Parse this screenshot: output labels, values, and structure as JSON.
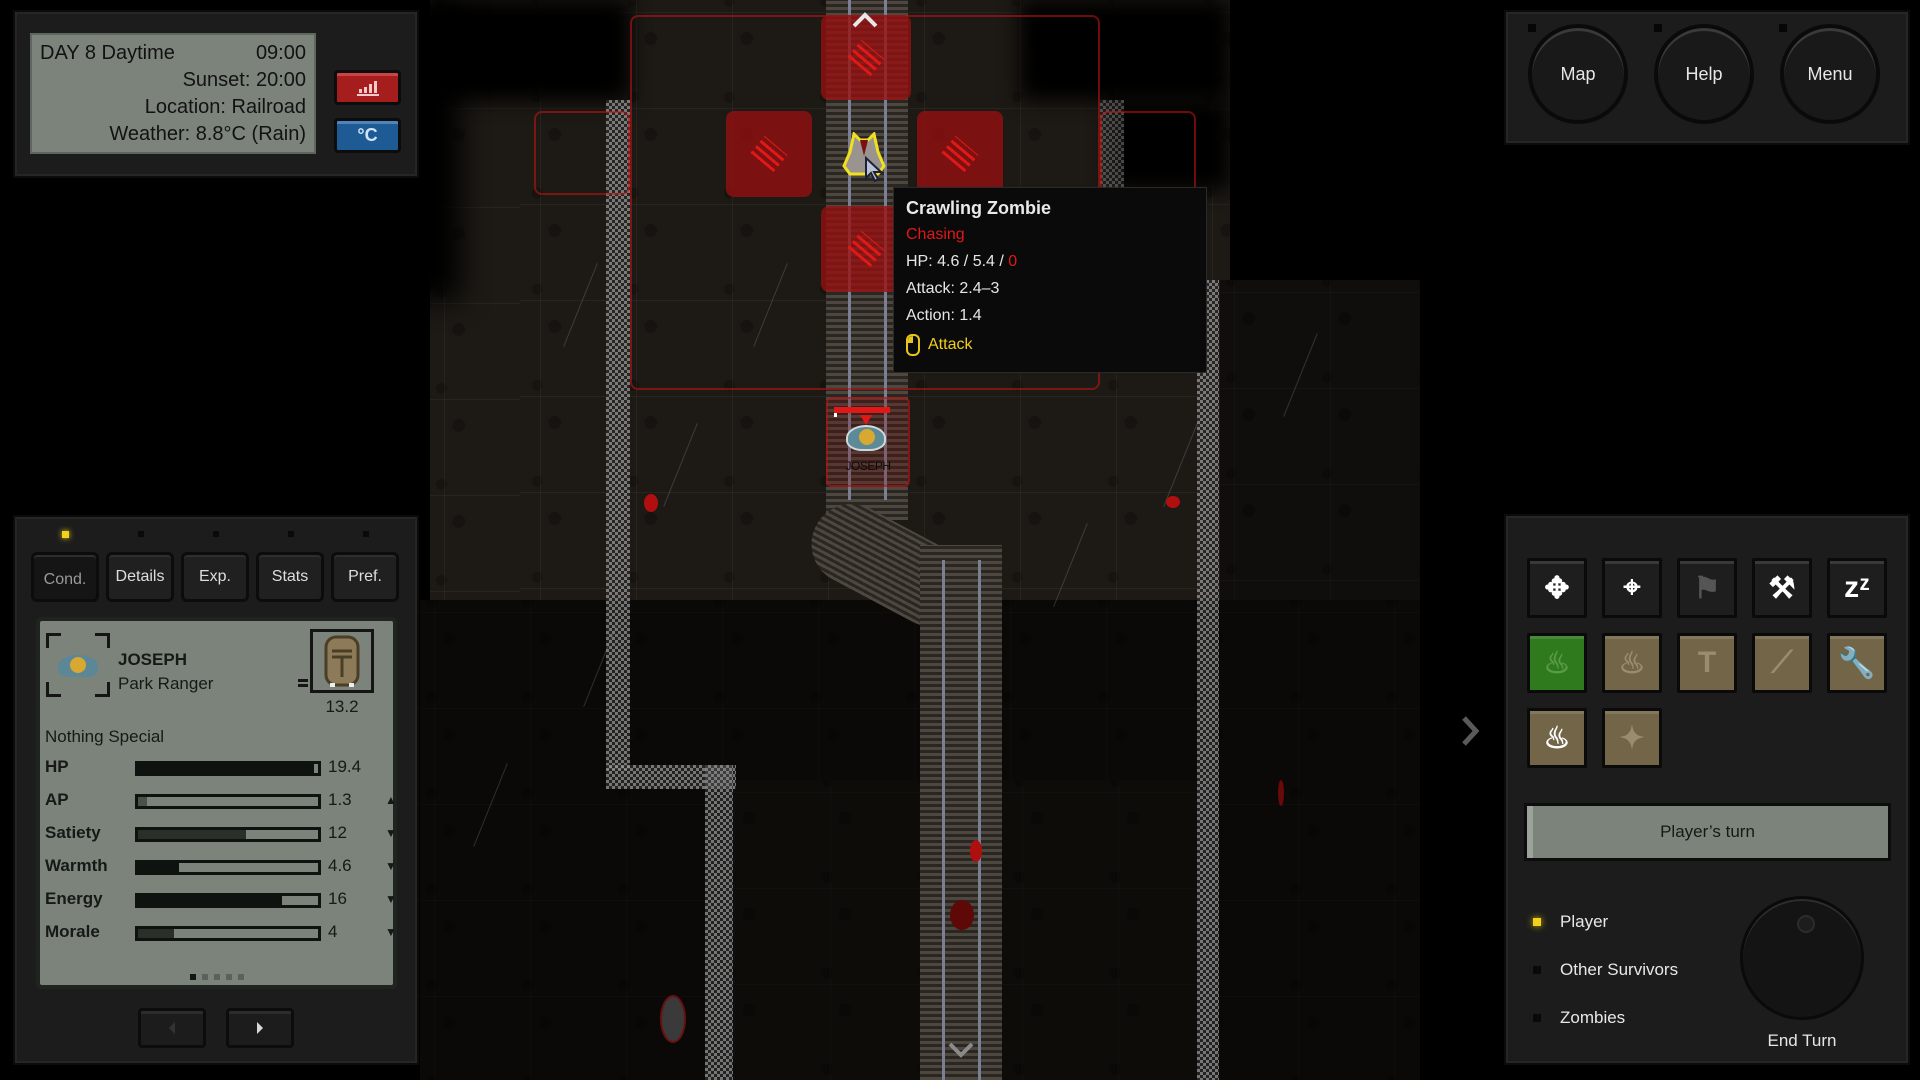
{
  "status": {
    "day_line": "DAY 8 Daytime",
    "time": "09:00",
    "sunset": "Sunset: 20:00",
    "location": "Location: Railroad",
    "weather": "Weather: 8.8°C (Rain)",
    "stats_button_icon": "bar-chart-icon",
    "temp_unit_button": "°C"
  },
  "top_menu": {
    "map": "Map",
    "help": "Help",
    "menu": "Menu"
  },
  "tooltip": {
    "name": "Crawling Zombie",
    "state": "Chasing",
    "hp_prefix": "HP: 4.6 / 5.4 / ",
    "hp_extra": "0",
    "attack": "Attack: 2.4–3",
    "action": "Action: 1.4",
    "click_action": "Attack",
    "click_icon": "mouse-left-click-icon"
  },
  "map": {
    "player_label": "JOSEPH",
    "scroll_up": "^",
    "scroll_down": "v",
    "scroll_right": "›"
  },
  "character": {
    "tabs": [
      {
        "label": "Cond.",
        "active": true
      },
      {
        "label": "Details",
        "active": false
      },
      {
        "label": "Exp.",
        "active": false
      },
      {
        "label": "Stats",
        "active": false
      },
      {
        "label": "Pref.",
        "active": false
      }
    ],
    "name": "JOSEPH",
    "profession": "Park Ranger",
    "carry_weight": "13.2",
    "condition": "Nothing Special",
    "stats": [
      {
        "label": "HP",
        "value": "19.4",
        "fill": 0.98,
        "trend": ""
      },
      {
        "label": "AP",
        "value": "1.3",
        "fill": 0.05,
        "trend": "up"
      },
      {
        "label": "Satiety",
        "value": "12",
        "fill": 0.6,
        "trend": "down"
      },
      {
        "label": "Warmth",
        "value": "4.6",
        "fill": 0.23,
        "trend": "down"
      },
      {
        "label": "Energy",
        "value": "16",
        "fill": 0.8,
        "trend": "down"
      },
      {
        "label": "Morale",
        "value": "4",
        "fill": 0.2,
        "trend": "down"
      }
    ],
    "page": 1,
    "page_count": 5
  },
  "actions": [
    {
      "name": "move-icon",
      "glyph": "✥",
      "style": "dark",
      "enabled": true
    },
    {
      "name": "target-icon",
      "glyph": "⌖",
      "style": "dark",
      "enabled": true
    },
    {
      "name": "signpost-icon",
      "glyph": "⚑",
      "style": "dark",
      "enabled": false
    },
    {
      "name": "build-anvil-icon",
      "glyph": "⚒",
      "style": "dark",
      "enabled": true
    },
    {
      "name": "sleep-icon",
      "glyph": "zᶻ",
      "style": "dark",
      "enabled": true
    },
    {
      "name": "campfire-icon",
      "glyph": "♨",
      "style": "green",
      "enabled": false
    },
    {
      "name": "cooking-icon",
      "glyph": "♨",
      "style": "tan",
      "enabled": false
    },
    {
      "name": "hammer-icon",
      "glyph": "T",
      "style": "tan",
      "enabled": false
    },
    {
      "name": "knife-icon",
      "glyph": "⟋",
      "style": "tan",
      "enabled": false
    },
    {
      "name": "wrench-icon",
      "glyph": "🔧",
      "style": "tan",
      "enabled": false
    },
    {
      "name": "make-fire-icon",
      "glyph": "♨",
      "style": "tan",
      "enabled": true
    },
    {
      "name": "flashlight-icon",
      "glyph": "✦",
      "style": "tan",
      "enabled": false
    }
  ],
  "turn": {
    "status": "Player’s turn",
    "phases": [
      {
        "label": "Player",
        "active": true
      },
      {
        "label": "Other Survivors",
        "active": false
      },
      {
        "label": "Zombies",
        "active": false
      }
    ],
    "end_turn": "End Turn"
  },
  "colors": {
    "accent_yellow": "#f2d21b",
    "danger_red": "#e01818",
    "screen_green_gray": "#7b837b",
    "action_green": "#2f7a1d",
    "action_tan": "#726548"
  }
}
